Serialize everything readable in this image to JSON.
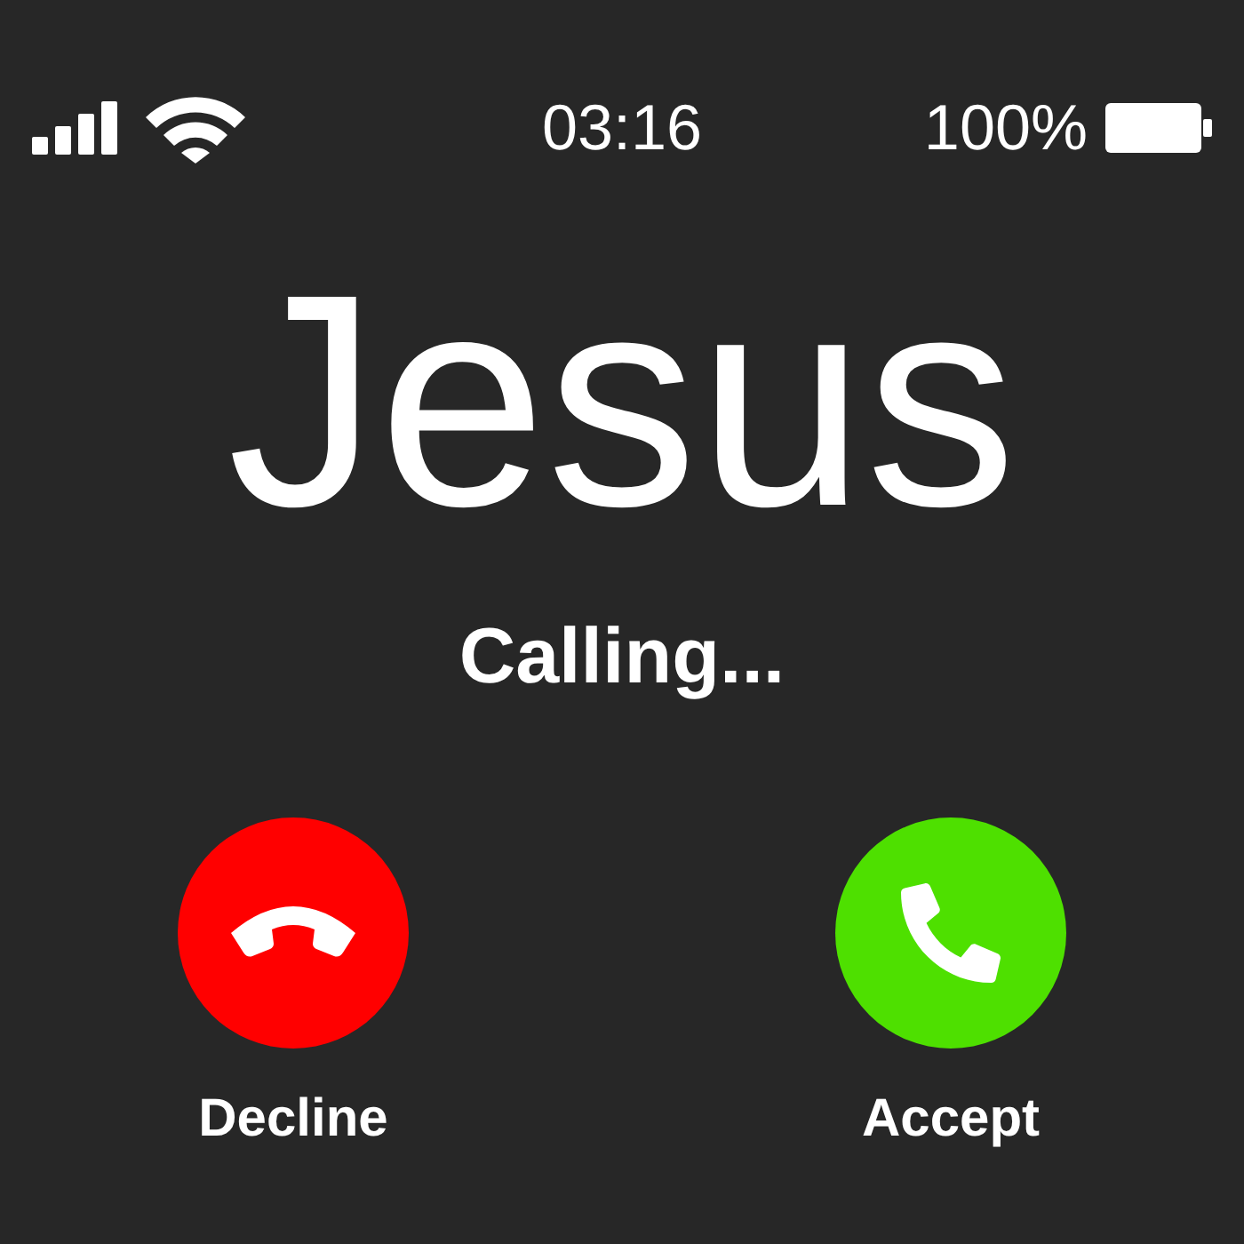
{
  "status_bar": {
    "time": "03:16",
    "battery": "100%"
  },
  "caller": {
    "name": "Jesus",
    "status": "Calling..."
  },
  "actions": [
    {
      "kind": "decline",
      "label": "Decline"
    },
    {
      "kind": "accept",
      "label": "Accept"
    }
  ]
}
